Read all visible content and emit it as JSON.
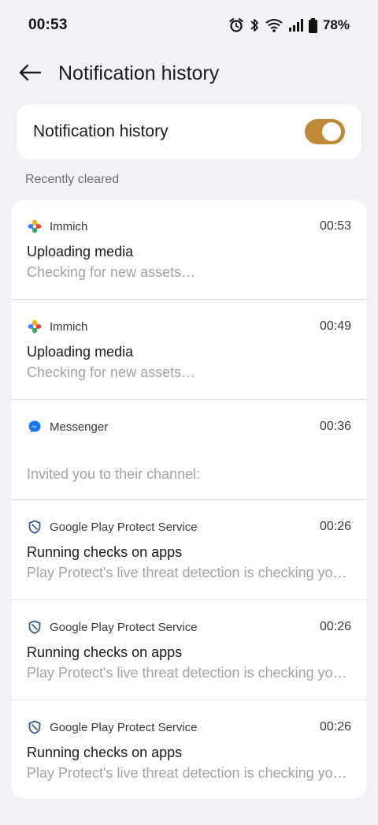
{
  "status_bar": {
    "time": "00:53",
    "icons": [
      "alarm-icon",
      "bluetooth-icon",
      "wifi-icon",
      "signal-icon",
      "battery-icon"
    ],
    "battery": "78%"
  },
  "app_bar": {
    "back_icon": "arrow-left-icon",
    "title": "Notification history"
  },
  "toggle_card": {
    "label": "Notification history",
    "enabled": true,
    "accent": "#c0893a"
  },
  "section": {
    "label": "Recently cleared"
  },
  "notifications": [
    {
      "app": "Immich",
      "icon": "immich-icon",
      "time": "00:53",
      "title": "Uploading media",
      "text": "Checking for new assets…"
    },
    {
      "app": "Immich",
      "icon": "immich-icon",
      "time": "00:49",
      "title": "Uploading media",
      "text": "Checking for new assets…"
    },
    {
      "app": "Messenger",
      "icon": "messenger-icon",
      "time": "00:36",
      "title": "",
      "text": "Invited you to their channel:"
    },
    {
      "app": "Google Play Protect Service",
      "icon": "shield-icon",
      "time": "00:26",
      "title": "Running checks on apps",
      "text": "Play Protect's live threat detection is checking your…"
    },
    {
      "app": "Google Play Protect Service",
      "icon": "shield-icon",
      "time": "00:26",
      "title": "Running checks on apps",
      "text": "Play Protect's live threat detection is checking your…"
    },
    {
      "app": "Google Play Protect Service",
      "icon": "shield-icon",
      "time": "00:26",
      "title": "Running checks on apps",
      "text": "Play Protect's live threat detection is checking your…"
    }
  ]
}
